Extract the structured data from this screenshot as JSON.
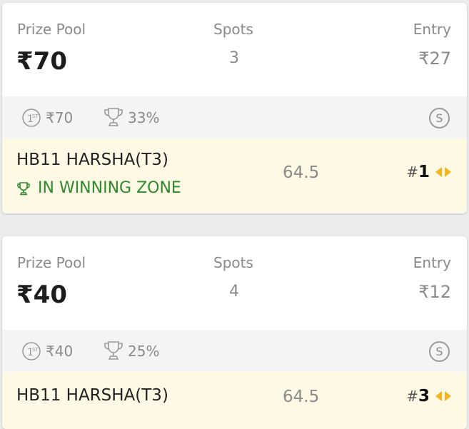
{
  "contests": [
    {
      "prize_pool_label": "Prize Pool",
      "prize_pool": "₹70",
      "spots_label": "Spots",
      "spots": "3",
      "entry_label": "Entry",
      "entry": "₹27",
      "first_prize": "₹70",
      "winners_percent": "33%",
      "badge": "S",
      "team_name": "HB11 HARSHA(T3)",
      "zone_text": "IN WINNING ZONE",
      "points": "64.5",
      "rank_prefix": "#",
      "rank": "1"
    },
    {
      "prize_pool_label": "Prize Pool",
      "prize_pool": "₹40",
      "spots_label": "Spots",
      "spots": "4",
      "entry_label": "Entry",
      "entry": "₹12",
      "first_prize": "₹40",
      "winners_percent": "25%",
      "badge": "S",
      "team_name": "HB11 HARSHA(T3)",
      "points": "64.5",
      "rank_prefix": "#",
      "rank": "3"
    }
  ],
  "colors": {
    "winning_zone": "#2e8a2e",
    "team_row_bg": "#fdf9e4",
    "rank_arrows": "#f2b51a"
  },
  "icons": {
    "first_prize": "first-place-medal-icon",
    "winners": "trophy-icon",
    "zone": "trophy-icon",
    "rank_change": "up-down-arrows-icon"
  }
}
